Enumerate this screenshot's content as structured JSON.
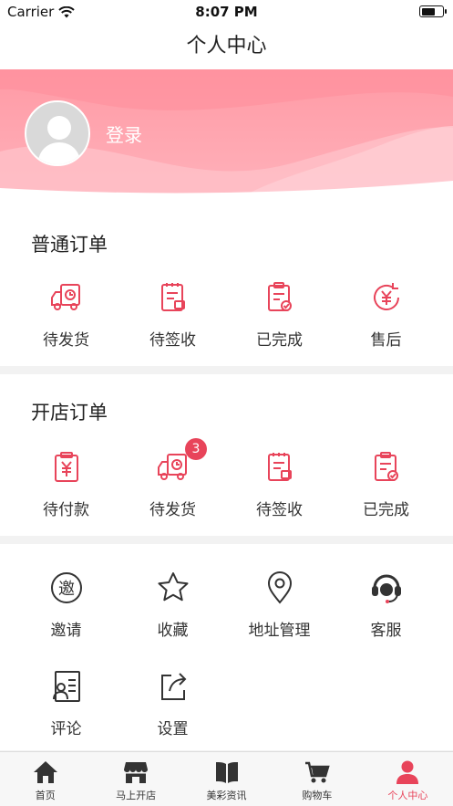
{
  "status": {
    "carrier": "Carrier",
    "time": "8:07 PM"
  },
  "nav": {
    "title": "个人中心"
  },
  "profile": {
    "login": "登录"
  },
  "normal_orders": {
    "title": "普通订单",
    "items": [
      {
        "label": "待发货",
        "icon": "truck-icon"
      },
      {
        "label": "待签收",
        "icon": "clipboard-icon"
      },
      {
        "label": "已完成",
        "icon": "clipboard-check-icon"
      },
      {
        "label": "售后",
        "icon": "yen-refresh-icon"
      }
    ]
  },
  "shop_orders": {
    "title": "开店订单",
    "items": [
      {
        "label": "待付款",
        "icon": "yen-clipboard-icon"
      },
      {
        "label": "待发货",
        "icon": "truck-icon",
        "badge": "3"
      },
      {
        "label": "待签收",
        "icon": "clipboard-icon"
      },
      {
        "label": "已完成",
        "icon": "clipboard-check-icon"
      }
    ]
  },
  "services": {
    "row1": [
      {
        "label": "邀请",
        "icon": "invite-icon"
      },
      {
        "label": "收藏",
        "icon": "star-icon"
      },
      {
        "label": "地址管理",
        "icon": "location-icon"
      },
      {
        "label": "客服",
        "icon": "headset-icon"
      }
    ],
    "row2": [
      {
        "label": "评论",
        "icon": "comment-icon"
      },
      {
        "label": "设置",
        "icon": "share-icon"
      }
    ]
  },
  "tabs": [
    {
      "label": "首页",
      "icon": "home-icon"
    },
    {
      "label": "马上开店",
      "icon": "shop-icon"
    },
    {
      "label": "美彩资讯",
      "icon": "book-icon"
    },
    {
      "label": "购物车",
      "icon": "cart-icon"
    },
    {
      "label": "个人中心",
      "icon": "person-icon",
      "active": true
    }
  ],
  "colors": {
    "accent": "#e8445a",
    "hero": "#ffb3bc"
  },
  "invite_glyph": "邀"
}
